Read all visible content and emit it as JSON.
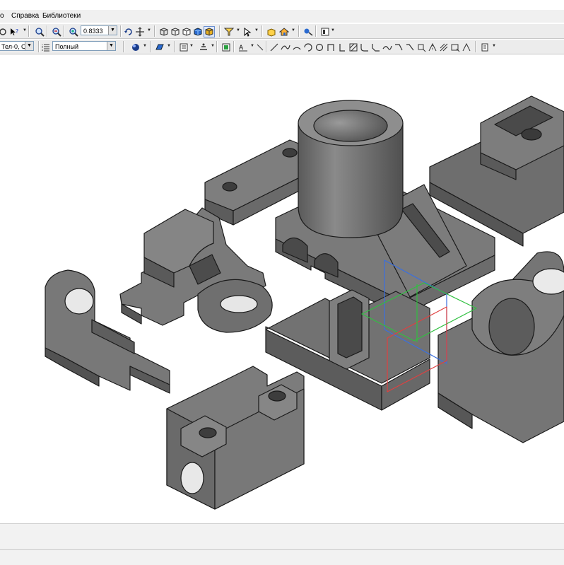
{
  "menu": {
    "items": [
      "o",
      "Справка",
      "Библиотеки"
    ]
  },
  "toolbar1": {
    "zoom_value": "0.8333",
    "icons": [
      "cursor-icon",
      "help-icon",
      "zoom-window-icon",
      "zoom-in-out-icon",
      "zoom-all-icon",
      "rotate-icon",
      "move-view-icon",
      "view-front-icon",
      "view-top-icon",
      "view-iso-icon",
      "shaded-icon",
      "filter-icon",
      "select-icon",
      "part-icon",
      "assembly-icon",
      "library-icon",
      "layout-icon"
    ]
  },
  "toolbar2": {
    "body_combo": "Тел-0, С",
    "mode_combo": "Полный",
    "icons": [
      "layers-icon",
      "color-icon",
      "material-icon",
      "properties-icon",
      "style-icon",
      "snap-icon",
      "text-icon",
      "line-icon",
      "spline-icon",
      "arc-icon",
      "circle-icon",
      "ellipse-icon",
      "rect-icon",
      "polygon-icon",
      "hatch-icon",
      "fillet-icon",
      "chamfer-icon",
      "trim-icon",
      "extend-icon",
      "break-icon",
      "offset-icon",
      "mirror-icon",
      "array-icon",
      "dimension-icon"
    ]
  },
  "colors": {
    "part_fill": "#6f6f6f",
    "part_dark": "#4e4e4e",
    "part_light": "#8c8c8c",
    "edge": "#1a1a1a",
    "plane_blue": "#3a6fe0",
    "plane_green": "#30c040",
    "plane_red": "#e04040"
  }
}
